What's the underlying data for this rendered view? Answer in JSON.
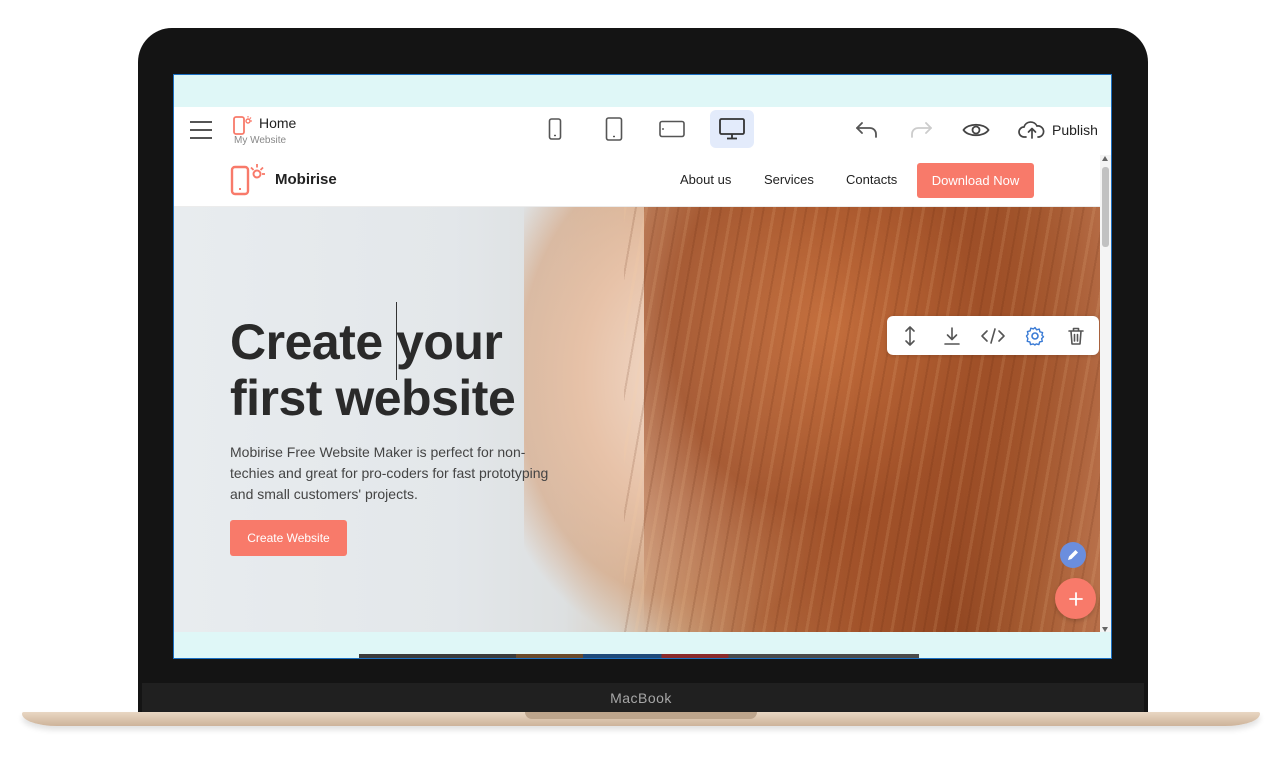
{
  "device": {
    "brand": "MacBook"
  },
  "editor": {
    "page_title": "Home",
    "site_name": "My Website",
    "devices": [
      "phone-icon",
      "tablet-icon",
      "tablet-landscape-icon",
      "desktop-icon"
    ],
    "active_device": "desktop",
    "publish_label": "Publish"
  },
  "site": {
    "brand": "Mobirise",
    "nav": [
      "About us",
      "Services",
      "Contacts"
    ],
    "cta_label": "Download Now",
    "hero": {
      "title_line1": "Create your",
      "title_line2": "first website",
      "description": "Mobirise Free Website Maker is perfect for non-techies and great for pro-coders for fast prototyping and small customers' projects.",
      "button_label": "Create Website"
    },
    "block_tools": [
      "move-icon",
      "download-icon",
      "code-icon",
      "gear-icon",
      "trash-icon"
    ]
  },
  "colors": {
    "accent": "#f87a6a",
    "active_device_bg": "#e3ebfb",
    "gear_blue": "#3a7bd5",
    "edit_fab": "#6b8ede",
    "screen_bg": "#dff7f7"
  }
}
